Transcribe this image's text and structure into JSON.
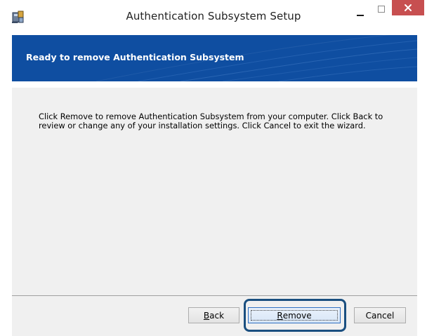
{
  "window": {
    "title": "Authentication Subsystem Setup",
    "accent_color": "#0f4ea1",
    "close_color": "#c74f50",
    "icons": [
      "installer-app-icon",
      "minimize-icon",
      "maximize-icon",
      "close-icon"
    ]
  },
  "banner": {
    "title": "Ready to remove Authentication Subsystem"
  },
  "body": {
    "line1": "Click Remove to remove Authentication Subsystem from your computer. Click Back to",
    "line2": "review or change any of your installation settings. Click Cancel to exit the wizard."
  },
  "buttons": {
    "back": {
      "accel": "B",
      "rest": "ack"
    },
    "remove": {
      "accel": "R",
      "rest": "emove"
    },
    "cancel": "Cancel"
  }
}
